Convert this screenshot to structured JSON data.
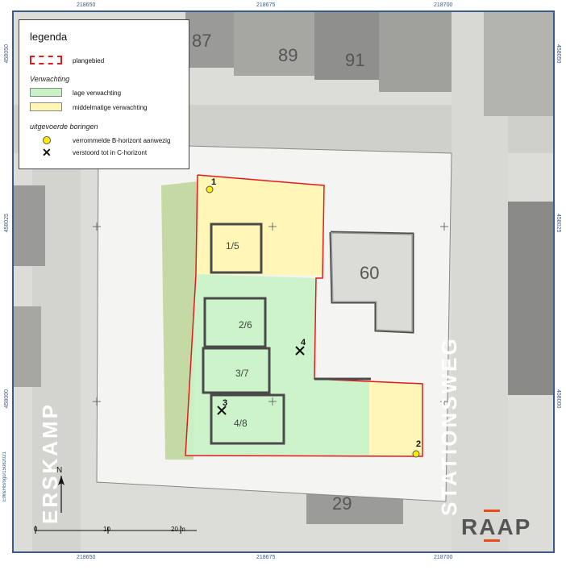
{
  "legend": {
    "title": "legenda",
    "items": [
      {
        "label": "plangebied",
        "color": "#e31a1c"
      },
      {
        "section": "Verwachting"
      },
      {
        "label": "lage verwachting",
        "color": "#c9f2c7"
      },
      {
        "label": "middelmatige verwachting",
        "color": "#fff6b3"
      },
      {
        "section": "uitgevoerde boringen"
      },
      {
        "label": "verrommelde B-horizont aanwezig",
        "color": "#ffeb00"
      },
      {
        "label": "verstoord tot in C-horizont",
        "color": "#111111"
      }
    ]
  },
  "axis": {
    "x_ticks": [
      "218650",
      "218675",
      "218700"
    ],
    "y_ticks": [
      "458050",
      "458025",
      "458000"
    ]
  },
  "street_labels": [
    "ERSKAMP",
    "STATIONSWEG"
  ],
  "house_numbers": [
    "87",
    "89",
    "91",
    "60",
    "29"
  ],
  "borings": [
    {
      "id": "1",
      "type": "verrommelde B-horizont aanwezig"
    },
    {
      "id": "2",
      "type": "verrommelde B-horizont aanwezig"
    },
    {
      "id": "3",
      "type": "verstoord tot in C-horizont"
    },
    {
      "id": "4",
      "type": "verstoord tot in C-horizont"
    }
  ],
  "sketch_labels": [
    "1/5",
    "2/6",
    "3/7",
    "4/8"
  ],
  "scale": {
    "labels": [
      "0",
      "10",
      "20 m"
    ]
  },
  "north": "N",
  "logo": "RAAP",
  "credit": "EW&HB/ogo/15082021"
}
